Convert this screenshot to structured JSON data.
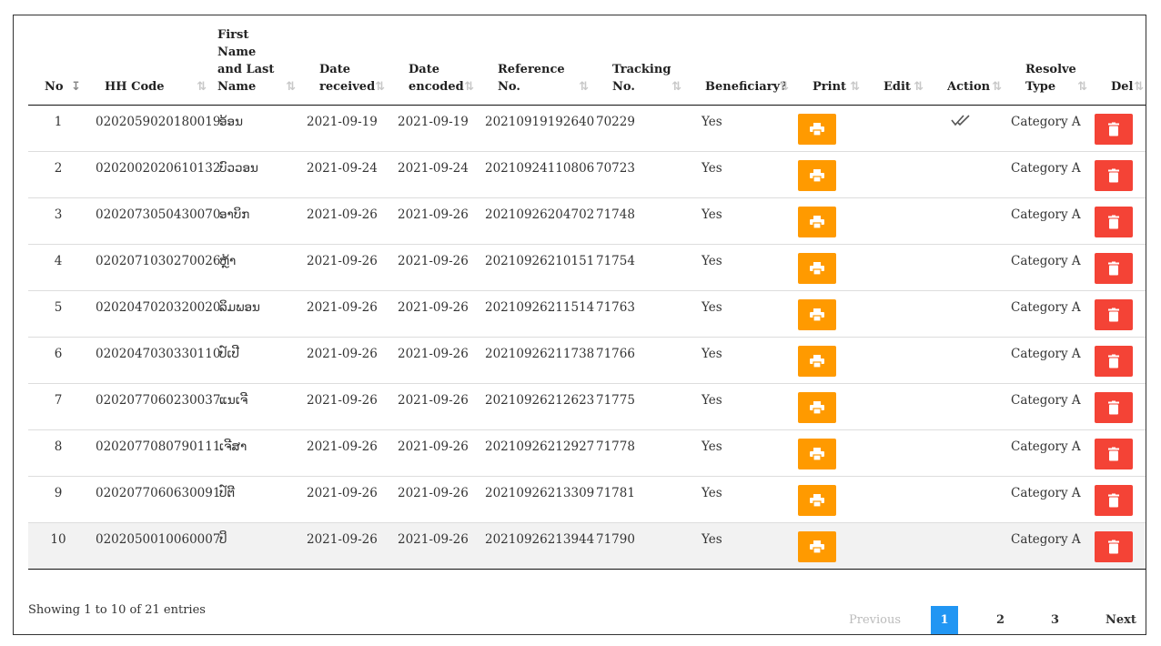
{
  "table": {
    "headers": [
      {
        "label": "No",
        "active": true
      },
      {
        "label": "HH Code"
      },
      {
        "label": "First Name and Last Name"
      },
      {
        "label": "Date received"
      },
      {
        "label": "Date encoded"
      },
      {
        "label": "Reference No."
      },
      {
        "label": "Tracking No."
      },
      {
        "label": "Beneficiary?"
      },
      {
        "label": "Print"
      },
      {
        "label": "Edit"
      },
      {
        "label": "Action"
      },
      {
        "label": "Resolve Type"
      },
      {
        "label": "Del"
      }
    ],
    "rows": [
      {
        "no": "1",
        "hh_code": "0202059020180019",
        "name": "ອ້ອນ",
        "date_received": "2021-09-19",
        "date_encoded": "2021-09-19",
        "reference_no": "20210919192640",
        "tracking_no": "70229",
        "beneficiary": "Yes",
        "action_checked": true,
        "resolve_type": "Category A"
      },
      {
        "no": "2",
        "hh_code": "0202002020610132",
        "name": "ບົວວອນ",
        "date_received": "2021-09-24",
        "date_encoded": "2021-09-24",
        "reference_no": "20210924110806",
        "tracking_no": "70723",
        "beneficiary": "Yes",
        "action_checked": false,
        "resolve_type": "Category A"
      },
      {
        "no": "3",
        "hh_code": "0202073050430070",
        "name": "ອາບິກ",
        "date_received": "2021-09-26",
        "date_encoded": "2021-09-26",
        "reference_no": "20210926204702",
        "tracking_no": "71748",
        "beneficiary": "Yes",
        "action_checked": false,
        "resolve_type": "Category A"
      },
      {
        "no": "4",
        "hh_code": "0202071030270026",
        "name": "ຫຼ້າ",
        "date_received": "2021-09-26",
        "date_encoded": "2021-09-26",
        "reference_no": "20210926210151",
        "tracking_no": "71754",
        "beneficiary": "Yes",
        "action_checked": false,
        "resolve_type": "Category A"
      },
      {
        "no": "5",
        "hh_code": "0202047020320020",
        "name": "ລິມພອນ",
        "date_received": "2021-09-26",
        "date_encoded": "2021-09-26",
        "reference_no": "20210926211514",
        "tracking_no": "71763",
        "beneficiary": "Yes",
        "action_checked": false,
        "resolve_type": "Category A"
      },
      {
        "no": "6",
        "hh_code": "0202047030330110",
        "name": "ປ໌ເປີ",
        "date_received": "2021-09-26",
        "date_encoded": "2021-09-26",
        "reference_no": "20210926211738",
        "tracking_no": "71766",
        "beneficiary": "Yes",
        "action_checked": false,
        "resolve_type": "Category A"
      },
      {
        "no": "7",
        "hh_code": "0202077060230037",
        "name": "ແນເຈີ",
        "date_received": "2021-09-26",
        "date_encoded": "2021-09-26",
        "reference_no": "20210926212623",
        "tracking_no": "71775",
        "beneficiary": "Yes",
        "action_checked": false,
        "resolve_type": "Category A"
      },
      {
        "no": "8",
        "hh_code": "0202077080790111",
        "name": "ເຈີສາ",
        "date_received": "2021-09-26",
        "date_encoded": "2021-09-26",
        "reference_no": "20210926212927",
        "tracking_no": "71778",
        "beneficiary": "Yes",
        "action_checked": false,
        "resolve_type": "Category A"
      },
      {
        "no": "9",
        "hh_code": "0202077060630091",
        "name": "ປ໌ຕີ",
        "date_received": "2021-09-26",
        "date_encoded": "2021-09-26",
        "reference_no": "20210926213309",
        "tracking_no": "71781",
        "beneficiary": "Yes",
        "action_checked": false,
        "resolve_type": "Category A"
      },
      {
        "no": "10",
        "hh_code": "0202050010060007",
        "name": "ປິ",
        "date_received": "2021-09-26",
        "date_encoded": "2021-09-26",
        "reference_no": "20210926213944",
        "tracking_no": "71790",
        "beneficiary": "Yes",
        "action_checked": false,
        "resolve_type": "Category A"
      }
    ]
  },
  "footer": {
    "info": "Showing 1 to 10 of 21 entries"
  },
  "pagination": {
    "previous": "Previous",
    "pages": [
      "1",
      "2",
      "3"
    ],
    "current": "1",
    "next": "Next"
  },
  "icons": {
    "sort": "sort-arrows-icon",
    "sort_active": "sort-ascending-icon",
    "print": "printer-icon",
    "delete": "trash-icon",
    "action": "double-check-icon"
  },
  "colors": {
    "print_button": "#ff9a00",
    "delete_button": "#f44336",
    "active_page": "#2196f3"
  }
}
